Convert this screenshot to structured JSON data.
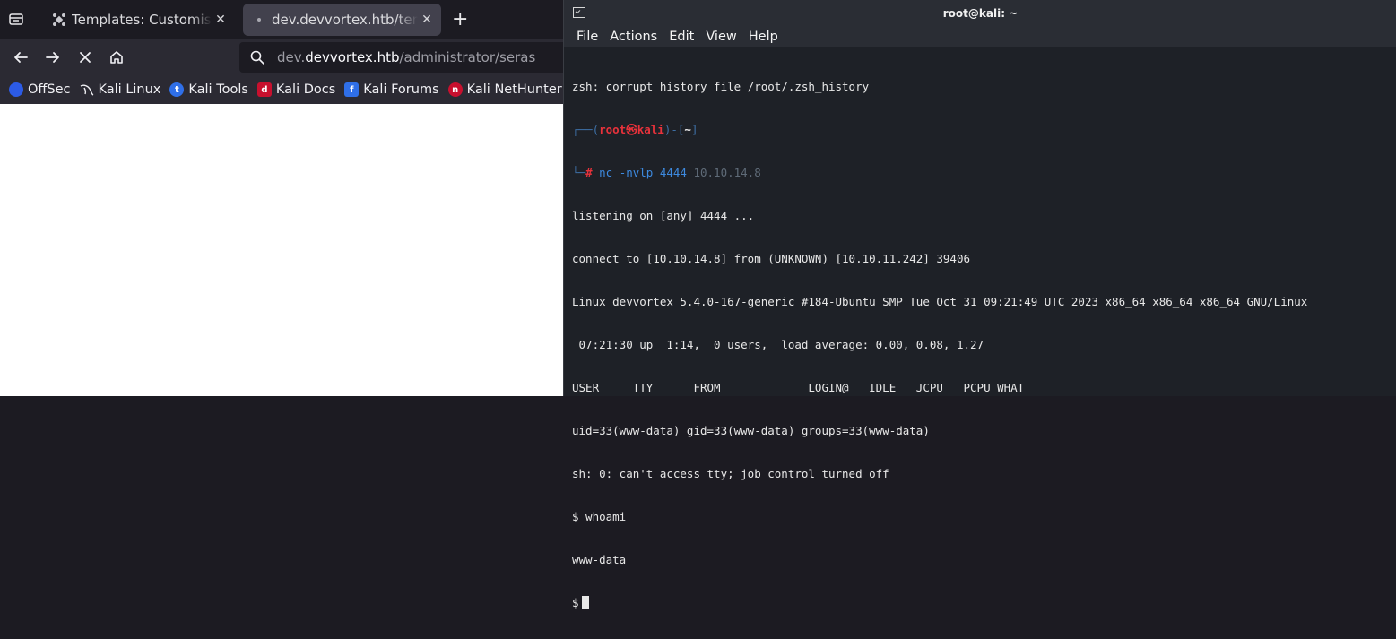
{
  "browser": {
    "tabs": [
      {
        "title": "Templates: Customise (Cassiopeia)",
        "favicon": "joomla-icon",
        "active": false
      },
      {
        "title": "dev.devvortex.htb/templates",
        "favicon": "loading-dot-icon",
        "active": true
      }
    ],
    "url": {
      "prefix": "dev.",
      "host": "devvortex.htb",
      "path": "/administrator/seras"
    },
    "bookmarks": [
      {
        "label": "OffSec",
        "icon": "offsec-icon",
        "color": "#2c5be6"
      },
      {
        "label": "Kali Linux",
        "icon": "kali-dragon-icon",
        "color": "#2b2a33"
      },
      {
        "label": "Kali Tools",
        "icon": "kali-tools-icon",
        "color": "#2f6fe8"
      },
      {
        "label": "Kali Docs",
        "icon": "kali-docs-icon",
        "color": "#c8102e"
      },
      {
        "label": "Kali Forums",
        "icon": "kali-forums-icon",
        "color": "#2f6fe8"
      },
      {
        "label": "Kali NetHunter",
        "icon": "nethunter-icon",
        "color": "#c8102e"
      }
    ]
  },
  "terminal": {
    "title": "root@kali: ~",
    "menu": [
      "File",
      "Actions",
      "Edit",
      "View",
      "Help"
    ],
    "lines": {
      "l0": "zsh: corrupt history file /root/.zsh_history",
      "prompt_open": "┌──(",
      "prompt_user": "root㉿kali",
      "prompt_mid": ")-[",
      "prompt_dir": "~",
      "prompt_close": "]",
      "prompt2": "└─",
      "prompt_hash": "#",
      "command": " nc -nvlp 4444",
      "ghost": " 10.10.14.8 ",
      "l3": "listening on [any] 4444 ...",
      "l4": "connect to [10.10.14.8] from (UNKNOWN) [10.10.11.242] 39406",
      "l5": "Linux devvortex 5.4.0-167-generic #184-Ubuntu SMP Tue Oct 31 09:21:49 UTC 2023 x86_64 x86_64 x86_64 GNU/Linux",
      "l6": " 07:21:30 up  1:14,  0 users,  load average: 0.00, 0.08, 1.27",
      "l7": "USER     TTY      FROM             LOGIN@   IDLE   JCPU   PCPU WHAT",
      "l8": "uid=33(www-data) gid=33(www-data) groups=33(www-data)",
      "l9": "sh: 0: can't access tty; job control turned off",
      "l10": "$ whoami",
      "l11": "www-data",
      "l12": "$"
    }
  }
}
